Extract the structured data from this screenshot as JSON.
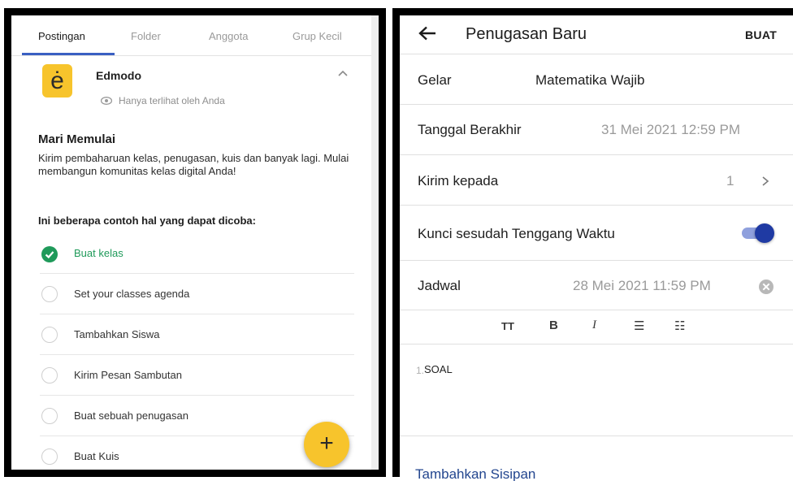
{
  "left": {
    "tabs": [
      "Postingan",
      "Folder",
      "Anggota",
      "Grup Kecil"
    ],
    "logo_letter": "ė",
    "brand": "Edmodo",
    "visibility_note": "Hanya terlihat oleh Anda",
    "heading": "Mari Memulai",
    "description": "Kirim pembaharuan kelas, penugasan, kuis dan banyak lagi. Mulai membangun komunitas kelas digital Anda!",
    "examples_heading": "Ini beberapa contoh hal yang dapat dicoba:",
    "tasks": [
      {
        "label": "Buat kelas",
        "done": true
      },
      {
        "label": "Set your classes agenda",
        "done": false
      },
      {
        "label": "Tambahkan Siswa",
        "done": false
      },
      {
        "label": "Kirim Pesan Sambutan",
        "done": false
      },
      {
        "label": "Buat sebuah penugasan",
        "done": false
      },
      {
        "label": "Buat Kuis",
        "done": false
      }
    ],
    "fab_label": "+",
    "colors": {
      "accent": "#f7c42c",
      "tab_active": "#3a5fc2",
      "done": "#1f9a5a"
    }
  },
  "right": {
    "title": "Penugasan Baru",
    "create_label": "BUAT",
    "title_row": {
      "label": "Gelar",
      "value": "Matematika Wajib"
    },
    "due_row": {
      "label": "Tanggal Berakhir",
      "value": "31 Mei 2021 12:59 PM"
    },
    "send_row": {
      "label": "Kirim kepada",
      "value": "1"
    },
    "lock_row": {
      "label": "Kunci sesudah Tenggang Waktu",
      "enabled": true
    },
    "schedule_row": {
      "label": "Jadwal",
      "value": "28 Mei 2021 11:59 PM"
    },
    "toolbar": {
      "text_size": "TT",
      "bold": "B",
      "italic": "I",
      "bullets": "☰",
      "numbered": "☷"
    },
    "editor": {
      "line_number": "1.",
      "content": "SOAL"
    },
    "attachment_label": "Tambahkan Sisipan",
    "colors": {
      "toggle_knob": "#1f3aa3",
      "toggle_track": "#8fa0dd",
      "link": "#23468f"
    }
  }
}
